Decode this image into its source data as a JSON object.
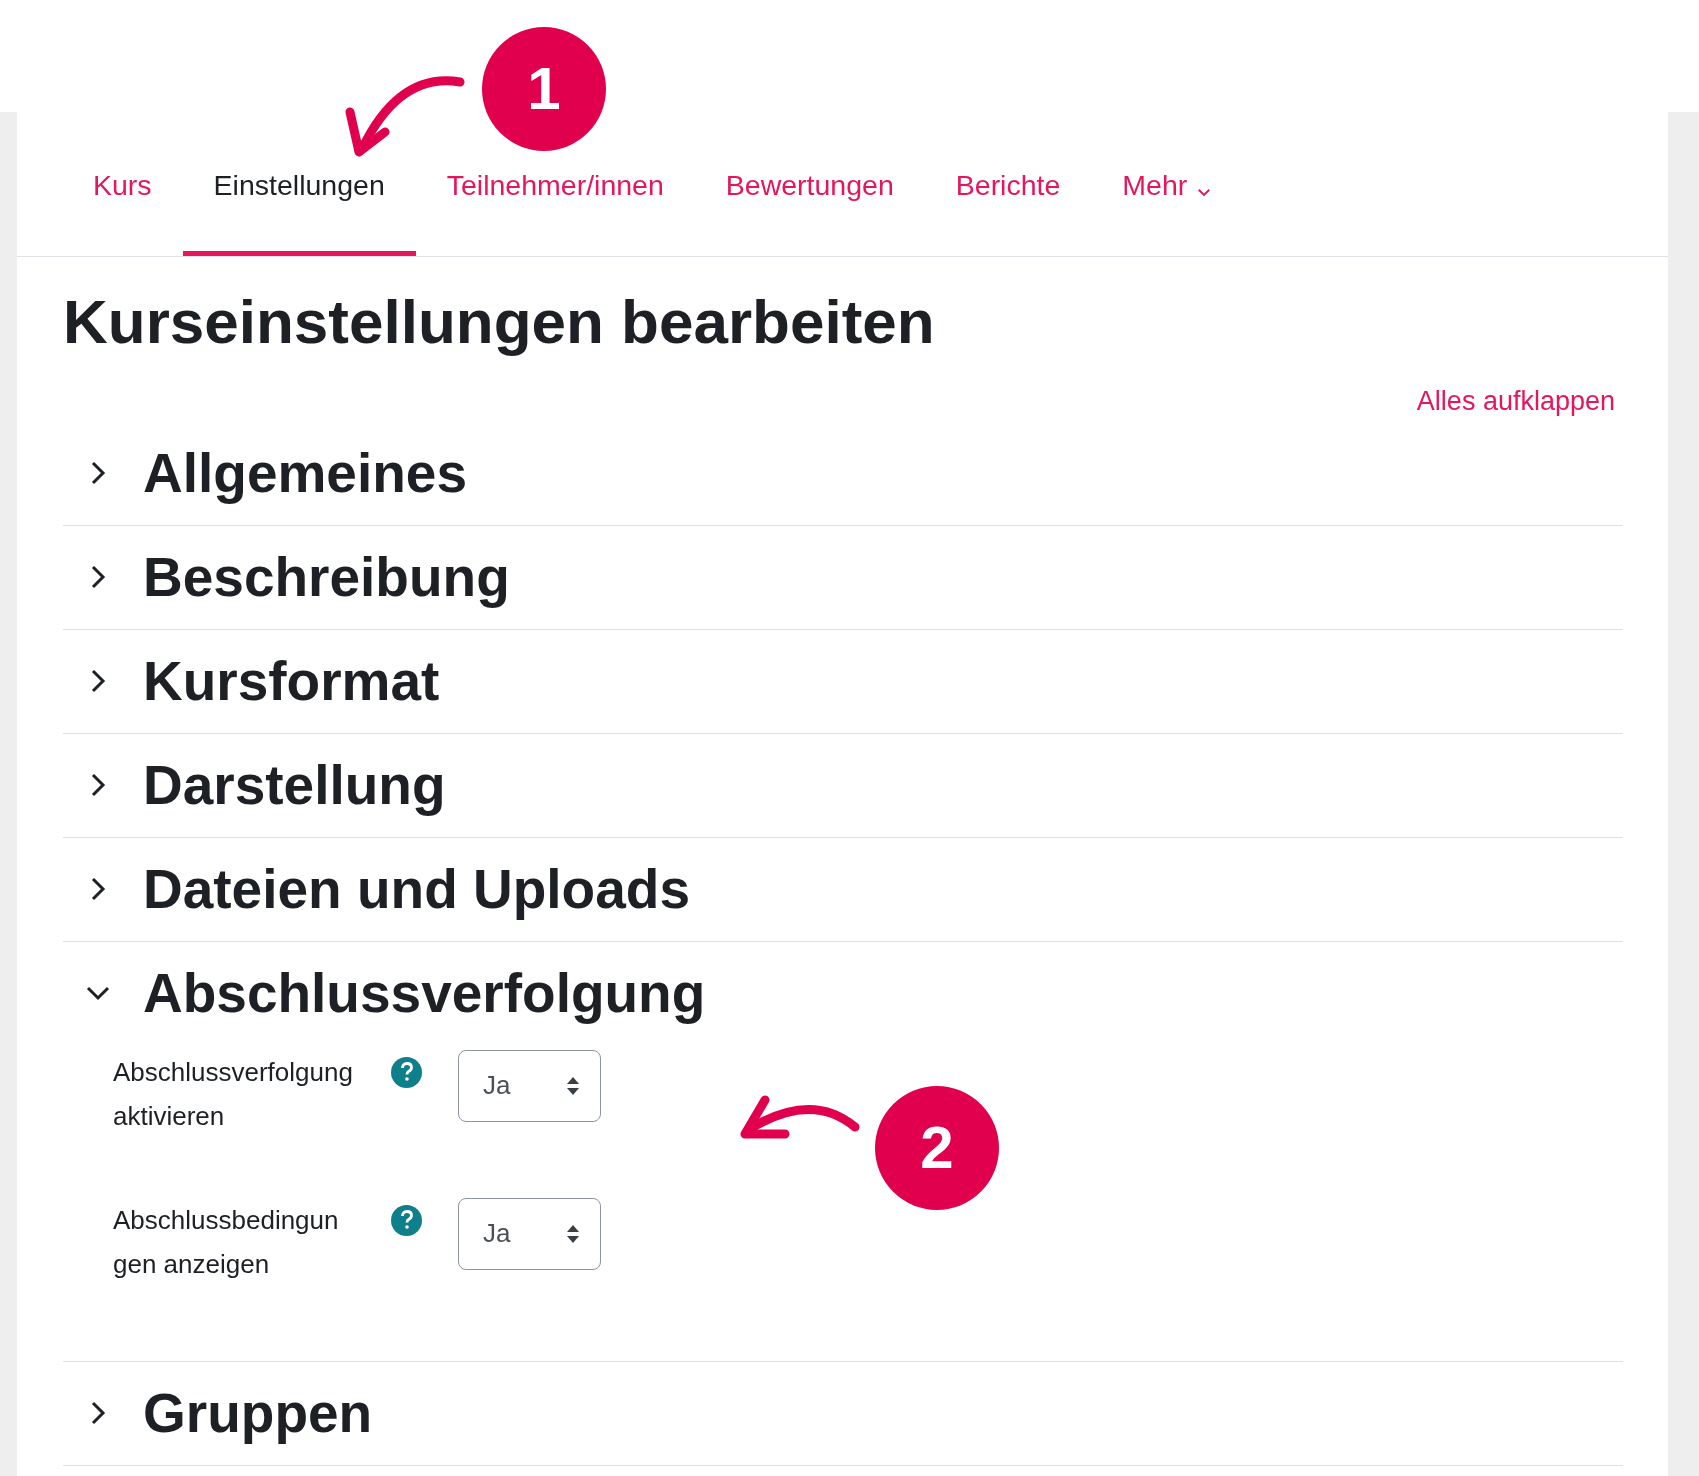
{
  "tabs": [
    {
      "label": "Kurs",
      "selected": false,
      "kind": "link"
    },
    {
      "label": "Einstellungen",
      "selected": true,
      "kind": "link"
    },
    {
      "label": "Teilnehmer/innen",
      "selected": false,
      "kind": "link"
    },
    {
      "label": "Bewertungen",
      "selected": false,
      "kind": "link"
    },
    {
      "label": "Berichte",
      "selected": false,
      "kind": "link"
    },
    {
      "label": "Mehr",
      "selected": false,
      "kind": "dropdown"
    }
  ],
  "page_title": "Kurseinstellungen bearbeiten",
  "expand_all_link": "Alles aufklappen",
  "sections": [
    {
      "title": "Allgemeines",
      "expanded": false
    },
    {
      "title": "Beschreibung",
      "expanded": false
    },
    {
      "title": "Kursformat",
      "expanded": false
    },
    {
      "title": "Darstellung",
      "expanded": false
    },
    {
      "title": "Dateien und Uploads",
      "expanded": false
    },
    {
      "title": "Abschlussverfolgung",
      "expanded": true,
      "fields": [
        {
          "label_lines": [
            "Abschlussverfolgung",
            "aktivieren"
          ],
          "value": "Ja"
        },
        {
          "label_lines": [
            "Abschlussbedingun",
            "gen anzeigen"
          ],
          "value": "Ja"
        }
      ]
    },
    {
      "title": "Gruppen",
      "expanded": false
    }
  ],
  "annotations": [
    {
      "number": "1"
    },
    {
      "number": "2"
    }
  ]
}
